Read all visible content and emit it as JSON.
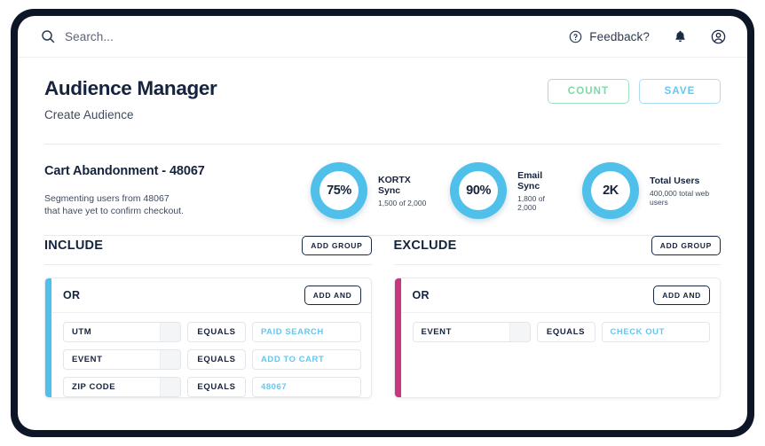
{
  "topbar": {
    "search_placeholder": "Search...",
    "search_value": "",
    "search_icon": "search-icon",
    "feedback_label": "Feedback?",
    "feedback_icon": "question-circle-icon",
    "bell_icon": "bell-icon",
    "account_icon": "user-circle-icon"
  },
  "header": {
    "title": "Audience Manager",
    "subtitle": "Create Audience",
    "count_label": "COUNT",
    "save_label": "SAVE",
    "count_color": "#7fd8a6",
    "save_color": "#63c7f2"
  },
  "audience": {
    "name": "Cart Abandonment - 48067",
    "description_line1": "Segmenting users from 48067",
    "description_line2": "that have yet to confirm checkout."
  },
  "stats": [
    {
      "value": "75%",
      "label": "KORTX Sync",
      "sub": "1,500 of 2,000",
      "ring_color": "#4fc0ea"
    },
    {
      "value": "90%",
      "label": "Email Sync",
      "sub": "1,800 of 2,000",
      "ring_color": "#4fc0ea"
    },
    {
      "value": "2K",
      "label": "Total Users",
      "sub": "400,000 total web users",
      "ring_color": "#4fc0ea"
    }
  ],
  "include": {
    "title": "INCLUDE",
    "add_group_label": "ADD GROUP",
    "accent_color": "#4fc0ea",
    "group": {
      "operator": "OR",
      "add_and_label": "ADD AND",
      "rules": [
        {
          "attribute": "UTM",
          "operator": "EQUALS",
          "value": "PAID SEARCH"
        },
        {
          "attribute": "EVENT",
          "operator": "EQUALS",
          "value": "ADD TO CART"
        },
        {
          "attribute": "ZIP CODE",
          "operator": "EQUALS",
          "value": "48067"
        }
      ]
    }
  },
  "exclude": {
    "title": "EXCLUDE",
    "add_group_label": "ADD GROUP",
    "accent_color": "#c8367f",
    "group": {
      "operator": "OR",
      "add_and_label": "ADD AND",
      "rules": [
        {
          "attribute": "EVENT",
          "operator": "EQUALS",
          "value": "CHECK OUT"
        }
      ]
    }
  }
}
